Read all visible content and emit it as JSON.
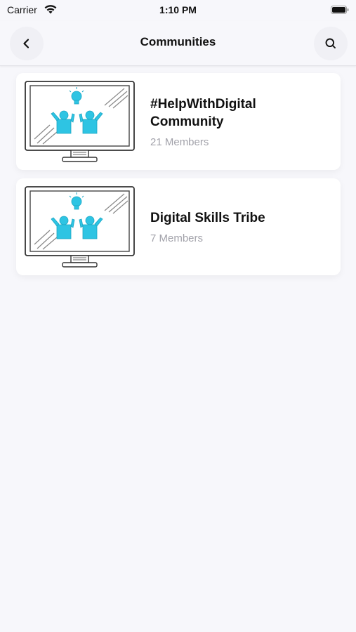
{
  "status_bar": {
    "carrier": "Carrier",
    "time": "1:10 PM"
  },
  "nav": {
    "title": "Communities",
    "back_icon": "chevron-left-icon",
    "search_icon": "search-icon"
  },
  "communities": [
    {
      "title": "#HelpWithDigital Community",
      "members": "21 Members",
      "image_icon": "monitor-team-illustration"
    },
    {
      "title": "Digital Skills Tribe",
      "members": "7 Members",
      "image_icon": "monitor-team-illustration"
    }
  ],
  "colors": {
    "background": "#f7f7fb",
    "accent_cyan": "#2ec4e3",
    "subtext": "#a2a2aa"
  }
}
